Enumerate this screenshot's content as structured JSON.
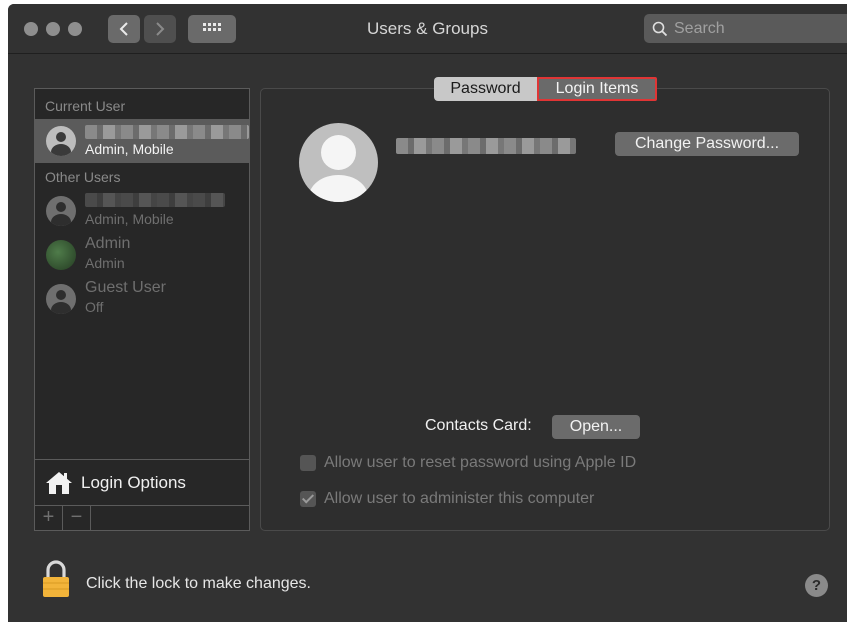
{
  "window": {
    "title": "Users & Groups"
  },
  "search": {
    "placeholder": "Search"
  },
  "sidebar": {
    "current_user_label": "Current User",
    "other_users_label": "Other Users",
    "current_user": {
      "role": "Admin, Mobile"
    },
    "other_users": [
      {
        "name": "",
        "role": "Admin, Mobile"
      },
      {
        "name": "Admin",
        "role": "Admin"
      },
      {
        "name": "Guest User",
        "role": "Off"
      }
    ],
    "login_options_label": "Login Options",
    "add_label": "+",
    "remove_label": "−"
  },
  "tabs": [
    {
      "label": "Password",
      "selected": false
    },
    {
      "label": "Login Items",
      "selected": true
    }
  ],
  "main": {
    "change_password_label": "Change Password...",
    "contacts_card_label": "Contacts Card:",
    "open_label": "Open...",
    "options": [
      {
        "label": "Allow user to reset password using Apple ID",
        "checked": false
      },
      {
        "label": "Allow user to administer this computer",
        "checked": true
      }
    ]
  },
  "footer": {
    "lock_text": "Click the lock to make changes.",
    "help_label": "?"
  }
}
